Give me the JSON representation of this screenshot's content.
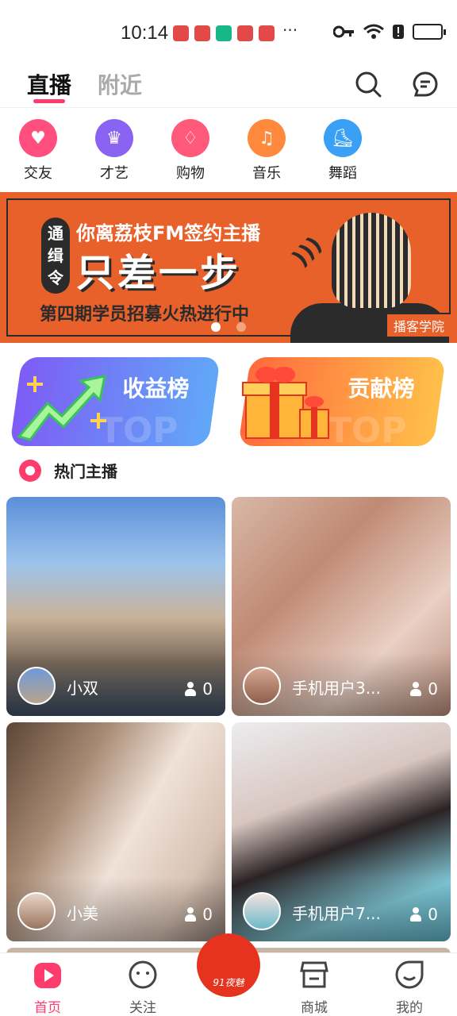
{
  "status_bar": {
    "time": "10:14",
    "more": "···"
  },
  "header": {
    "tabs": [
      {
        "label": "直播",
        "active": true
      },
      {
        "label": "附近",
        "active": false
      }
    ]
  },
  "categories": [
    {
      "label": "交友",
      "icon": "heart-icon",
      "color": "#ff4f7e"
    },
    {
      "label": "才艺",
      "icon": "jacket-icon",
      "color": "#8a63f3"
    },
    {
      "label": "购物",
      "icon": "dress-icon",
      "color": "#ff5a7a"
    },
    {
      "label": "音乐",
      "icon": "music-note-icon",
      "color": "#ff8a3d"
    },
    {
      "label": "舞蹈",
      "icon": "skate-icon",
      "color": "#3aa0f5"
    }
  ],
  "banner": {
    "tag": "通缉令",
    "line1": "你离荔枝FM签约主播",
    "line2": "只差一步",
    "line3": "第四期学员招募火热进行中",
    "corner": "播客学院"
  },
  "ranks": {
    "income_label": "收益榜",
    "contrib_label": "贡献榜",
    "ghost": "TOP"
  },
  "section": {
    "title": "热门主播"
  },
  "streamers": [
    {
      "name": "小双",
      "viewers": "0"
    },
    {
      "name": "手机用户3...",
      "viewers": "0"
    },
    {
      "name": "小美",
      "viewers": "0"
    },
    {
      "name": "手机用户7...",
      "viewers": "0"
    }
  ],
  "nav": {
    "home": "首页",
    "follow": "关注",
    "logo": "91夜魅",
    "shop": "商城",
    "mine": "我的"
  },
  "colors": {
    "accent": "#ff3b6b",
    "banner": "#e8612a"
  }
}
